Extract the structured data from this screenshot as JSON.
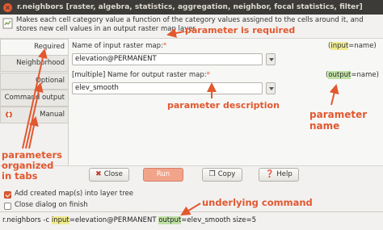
{
  "window": {
    "close_glyph": "×",
    "title": "r.neighbors [raster, algebra, statistics, aggregation, neighbor, focal statistics, filter]"
  },
  "description": "Makes each cell category value a function of the category values assigned to the cells around it, and stores new cell values in an output raster map layer.",
  "tabs": [
    {
      "label": "Required"
    },
    {
      "label": "Neighborhood"
    },
    {
      "label": "Optional"
    },
    {
      "label": "Command output"
    },
    {
      "label": "Manual"
    }
  ],
  "fields": {
    "input": {
      "label": "Name of input raster map:",
      "star": "*",
      "key_prefix": "(",
      "key": "input",
      "key_suffix": "=name)",
      "value": "elevation@PERMANENT"
    },
    "output": {
      "label": "[multiple] Name for output raster map:",
      "star": "*",
      "key_prefix": "(",
      "key": "output",
      "key_suffix": "=name)",
      "value": "elev_smooth"
    }
  },
  "buttons": {
    "close": "Close",
    "run": "Run",
    "copy": "Copy",
    "help": "Help"
  },
  "checkboxes": [
    {
      "label": "Add created map(s) into layer tree",
      "checked": true
    },
    {
      "label": "Close dialog on finish",
      "checked": false
    }
  ],
  "command": {
    "prefix": "r.neighbors -c ",
    "input_key": "input",
    "input_val": "=elevation@PERMANENT ",
    "output_key": "output",
    "output_val": "=elev_smooth size=5"
  },
  "annotations": {
    "required": "parameter is required",
    "description": "parameter description",
    "name_line1": "parameter",
    "name_line2": "name",
    "tabs_line1": "parameters",
    "tabs_line2": "organized",
    "tabs_line3": "in tabs",
    "command": "underlying command"
  },
  "colors": {
    "accent": "#e2582f",
    "input_highlight": "#f0eb8f",
    "output_highlight": "#bfe0a4",
    "titlebar": "#3c3b37"
  }
}
